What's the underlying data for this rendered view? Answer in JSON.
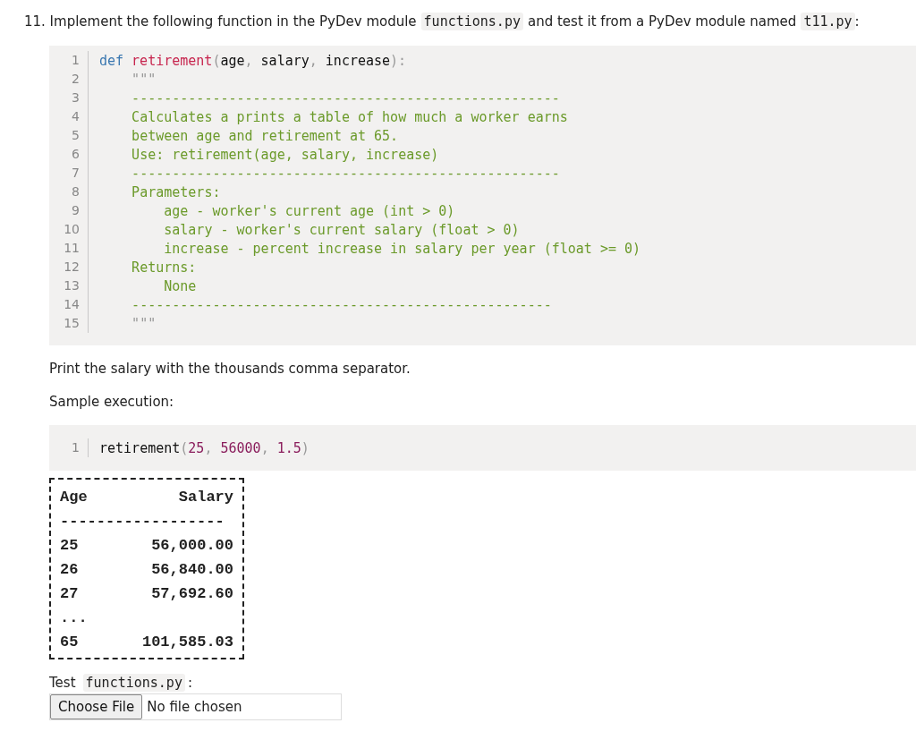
{
  "prompt": [
    {
      "kind": "text",
      "text": "11. Implement the following function in the PyDev module"
    },
    {
      "kind": "code",
      "text": "functions.py"
    },
    {
      "kind": "text",
      "text": "and test it from a PyDev module named"
    },
    {
      "kind": "code",
      "text": "t11.py"
    },
    {
      "kind": "punct",
      "text": ":"
    }
  ],
  "code_block": {
    "lines": [
      {
        "number": "1",
        "tokens": [
          {
            "kind": "keyword",
            "text": "def"
          },
          {
            "kind": "name",
            "text": "retirement"
          },
          {
            "kind": "punct",
            "text": "("
          },
          {
            "kind": "plain",
            "text": "age"
          },
          {
            "kind": "punct",
            "text": ", "
          },
          {
            "kind": "plain",
            "text": "salary"
          },
          {
            "kind": "punct",
            "text": ", "
          },
          {
            "kind": "plain",
            "text": "increase"
          },
          {
            "kind": "punct",
            "text": "):"
          }
        ]
      },
      {
        "number": "2",
        "tokens": [
          {
            "kind": "punct",
            "text": "    \"\"\""
          }
        ]
      },
      {
        "number": "3",
        "tokens": [
          {
            "kind": "doc",
            "text": "    -----------------------------------------------------"
          }
        ]
      },
      {
        "number": "4",
        "tokens": [
          {
            "kind": "doc",
            "text": "    Calculates a prints a table of how much a worker earns"
          }
        ]
      },
      {
        "number": "5",
        "tokens": [
          {
            "kind": "doc",
            "text": "    between age and retirement at 65."
          }
        ]
      },
      {
        "number": "6",
        "tokens": [
          {
            "kind": "doc",
            "text": "    Use: retirement(age, salary, increase)"
          }
        ]
      },
      {
        "number": "7",
        "tokens": [
          {
            "kind": "doc",
            "text": "    -----------------------------------------------------"
          }
        ]
      },
      {
        "number": "8",
        "tokens": [
          {
            "kind": "doc",
            "text": "    Parameters:"
          }
        ]
      },
      {
        "number": "9",
        "tokens": [
          {
            "kind": "doc",
            "text": "        age - worker's current age (int > 0)"
          }
        ]
      },
      {
        "number": "10",
        "tokens": [
          {
            "kind": "doc",
            "text": "        salary - worker's current salary (float > 0)"
          }
        ]
      },
      {
        "number": "11",
        "tokens": [
          {
            "kind": "doc",
            "text": "        increase - percent increase in salary per year (float >= 0)"
          }
        ]
      },
      {
        "number": "12",
        "tokens": [
          {
            "kind": "doc",
            "text": "    Returns:"
          }
        ]
      },
      {
        "number": "13",
        "tokens": [
          {
            "kind": "doc",
            "text": "        None"
          }
        ]
      },
      {
        "number": "14",
        "tokens": [
          {
            "kind": "doc",
            "text": "    ----------------------------------------------------"
          }
        ]
      },
      {
        "number": "15",
        "tokens": [
          {
            "kind": "punct",
            "text": "    \"\"\""
          }
        ]
      }
    ]
  },
  "note": "Print the salary with the thousands comma separator.",
  "sample_label": "Sample execution:",
  "sample_code": {
    "lines": [
      {
        "number": "1",
        "tokens": [
          {
            "kind": "plain",
            "text": "retirement"
          },
          {
            "kind": "punct",
            "text": "("
          },
          {
            "kind": "number",
            "text": "25"
          },
          {
            "kind": "punct",
            "text": ", "
          },
          {
            "kind": "number",
            "text": "56000"
          },
          {
            "kind": "punct",
            "text": ", "
          },
          {
            "kind": "number",
            "text": "1.5"
          },
          {
            "kind": "punct",
            "text": ")"
          }
        ]
      }
    ]
  },
  "output": {
    "header": {
      "age": "Age",
      "salary": "Salary"
    },
    "rule": "------------------",
    "rows": [
      {
        "age": "25",
        "salary": "56,000.00"
      },
      {
        "age": "26",
        "salary": "56,840.00"
      },
      {
        "age": "27",
        "salary": "57,692.60"
      },
      {
        "age": "...",
        "salary": ""
      },
      {
        "age": "65",
        "salary": "101,585.03"
      }
    ]
  },
  "test_label": [
    {
      "kind": "text",
      "text": "Test"
    },
    {
      "kind": "code",
      "text": "functions.py"
    },
    {
      "kind": "punct",
      "text": ":"
    }
  ],
  "file_input": {
    "button": "Choose File",
    "status": "No file chosen"
  }
}
